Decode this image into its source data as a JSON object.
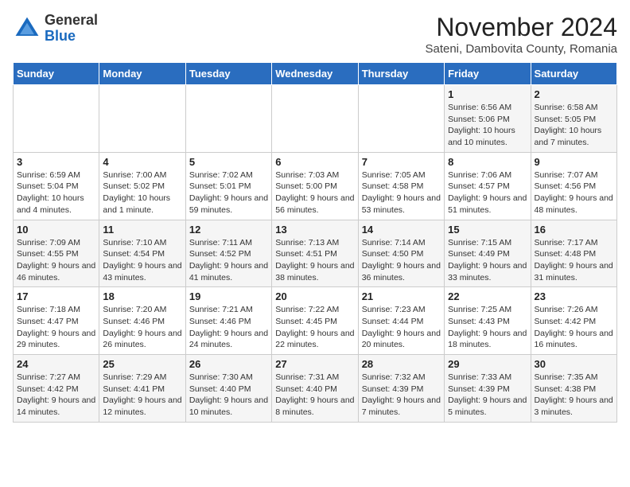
{
  "logo": {
    "general": "General",
    "blue": "Blue"
  },
  "title": "November 2024",
  "subtitle": "Sateni, Dambovita County, Romania",
  "days_of_week": [
    "Sunday",
    "Monday",
    "Tuesday",
    "Wednesday",
    "Thursday",
    "Friday",
    "Saturday"
  ],
  "weeks": [
    [
      {
        "day": "",
        "info": ""
      },
      {
        "day": "",
        "info": ""
      },
      {
        "day": "",
        "info": ""
      },
      {
        "day": "",
        "info": ""
      },
      {
        "day": "",
        "info": ""
      },
      {
        "day": "1",
        "info": "Sunrise: 6:56 AM\nSunset: 5:06 PM\nDaylight: 10 hours and 10 minutes."
      },
      {
        "day": "2",
        "info": "Sunrise: 6:58 AM\nSunset: 5:05 PM\nDaylight: 10 hours and 7 minutes."
      }
    ],
    [
      {
        "day": "3",
        "info": "Sunrise: 6:59 AM\nSunset: 5:04 PM\nDaylight: 10 hours and 4 minutes."
      },
      {
        "day": "4",
        "info": "Sunrise: 7:00 AM\nSunset: 5:02 PM\nDaylight: 10 hours and 1 minute."
      },
      {
        "day": "5",
        "info": "Sunrise: 7:02 AM\nSunset: 5:01 PM\nDaylight: 9 hours and 59 minutes."
      },
      {
        "day": "6",
        "info": "Sunrise: 7:03 AM\nSunset: 5:00 PM\nDaylight: 9 hours and 56 minutes."
      },
      {
        "day": "7",
        "info": "Sunrise: 7:05 AM\nSunset: 4:58 PM\nDaylight: 9 hours and 53 minutes."
      },
      {
        "day": "8",
        "info": "Sunrise: 7:06 AM\nSunset: 4:57 PM\nDaylight: 9 hours and 51 minutes."
      },
      {
        "day": "9",
        "info": "Sunrise: 7:07 AM\nSunset: 4:56 PM\nDaylight: 9 hours and 48 minutes."
      }
    ],
    [
      {
        "day": "10",
        "info": "Sunrise: 7:09 AM\nSunset: 4:55 PM\nDaylight: 9 hours and 46 minutes."
      },
      {
        "day": "11",
        "info": "Sunrise: 7:10 AM\nSunset: 4:54 PM\nDaylight: 9 hours and 43 minutes."
      },
      {
        "day": "12",
        "info": "Sunrise: 7:11 AM\nSunset: 4:52 PM\nDaylight: 9 hours and 41 minutes."
      },
      {
        "day": "13",
        "info": "Sunrise: 7:13 AM\nSunset: 4:51 PM\nDaylight: 9 hours and 38 minutes."
      },
      {
        "day": "14",
        "info": "Sunrise: 7:14 AM\nSunset: 4:50 PM\nDaylight: 9 hours and 36 minutes."
      },
      {
        "day": "15",
        "info": "Sunrise: 7:15 AM\nSunset: 4:49 PM\nDaylight: 9 hours and 33 minutes."
      },
      {
        "day": "16",
        "info": "Sunrise: 7:17 AM\nSunset: 4:48 PM\nDaylight: 9 hours and 31 minutes."
      }
    ],
    [
      {
        "day": "17",
        "info": "Sunrise: 7:18 AM\nSunset: 4:47 PM\nDaylight: 9 hours and 29 minutes."
      },
      {
        "day": "18",
        "info": "Sunrise: 7:20 AM\nSunset: 4:46 PM\nDaylight: 9 hours and 26 minutes."
      },
      {
        "day": "19",
        "info": "Sunrise: 7:21 AM\nSunset: 4:46 PM\nDaylight: 9 hours and 24 minutes."
      },
      {
        "day": "20",
        "info": "Sunrise: 7:22 AM\nSunset: 4:45 PM\nDaylight: 9 hours and 22 minutes."
      },
      {
        "day": "21",
        "info": "Sunrise: 7:23 AM\nSunset: 4:44 PM\nDaylight: 9 hours and 20 minutes."
      },
      {
        "day": "22",
        "info": "Sunrise: 7:25 AM\nSunset: 4:43 PM\nDaylight: 9 hours and 18 minutes."
      },
      {
        "day": "23",
        "info": "Sunrise: 7:26 AM\nSunset: 4:42 PM\nDaylight: 9 hours and 16 minutes."
      }
    ],
    [
      {
        "day": "24",
        "info": "Sunrise: 7:27 AM\nSunset: 4:42 PM\nDaylight: 9 hours and 14 minutes."
      },
      {
        "day": "25",
        "info": "Sunrise: 7:29 AM\nSunset: 4:41 PM\nDaylight: 9 hours and 12 minutes."
      },
      {
        "day": "26",
        "info": "Sunrise: 7:30 AM\nSunset: 4:40 PM\nDaylight: 9 hours and 10 minutes."
      },
      {
        "day": "27",
        "info": "Sunrise: 7:31 AM\nSunset: 4:40 PM\nDaylight: 9 hours and 8 minutes."
      },
      {
        "day": "28",
        "info": "Sunrise: 7:32 AM\nSunset: 4:39 PM\nDaylight: 9 hours and 7 minutes."
      },
      {
        "day": "29",
        "info": "Sunrise: 7:33 AM\nSunset: 4:39 PM\nDaylight: 9 hours and 5 minutes."
      },
      {
        "day": "30",
        "info": "Sunrise: 7:35 AM\nSunset: 4:38 PM\nDaylight: 9 hours and 3 minutes."
      }
    ]
  ]
}
